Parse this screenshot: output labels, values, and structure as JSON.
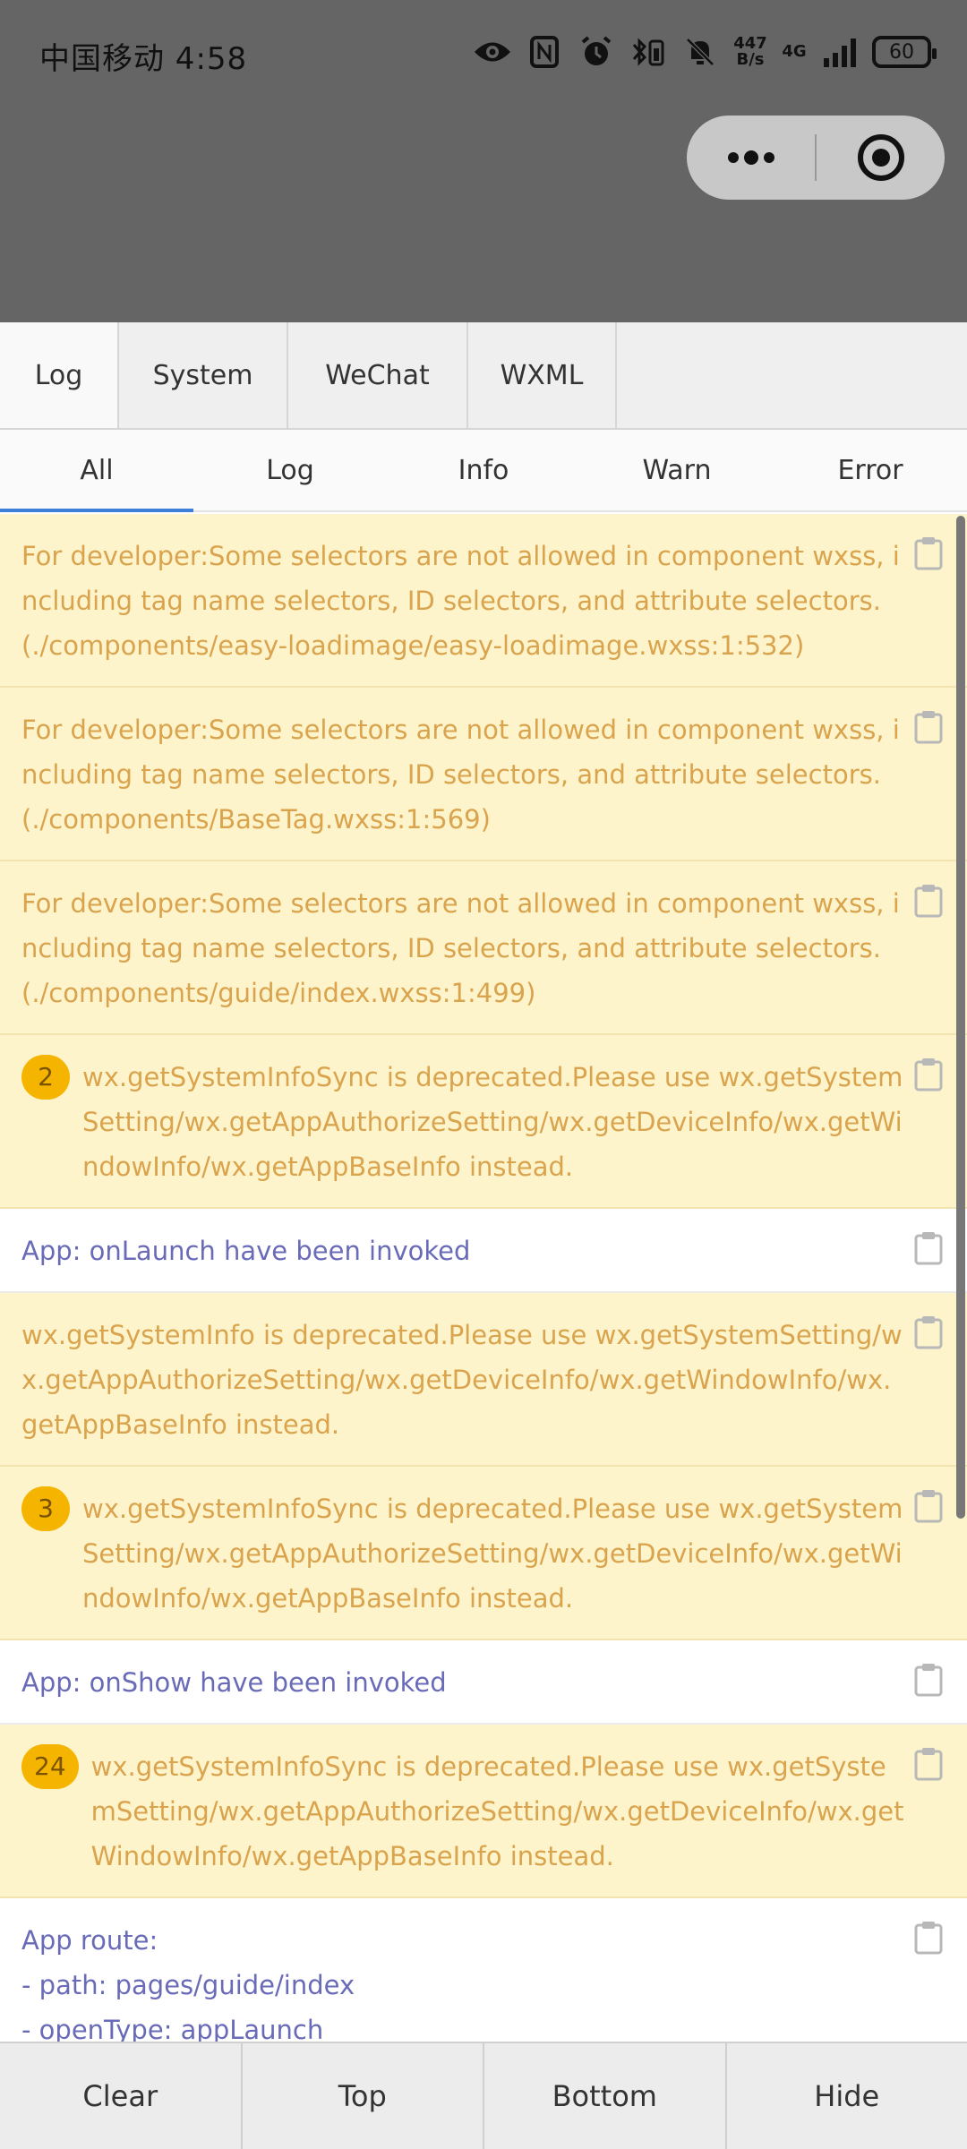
{
  "status_bar": {
    "carrier_time": "中国移动 4:58",
    "net_speed_top": "447",
    "net_speed_bottom": "B/s",
    "network": "4G",
    "battery": "60"
  },
  "tabs": [
    {
      "label": "Log"
    },
    {
      "label": "System"
    },
    {
      "label": "WeChat"
    },
    {
      "label": "WXML"
    }
  ],
  "filters": [
    {
      "label": "All"
    },
    {
      "label": "Log"
    },
    {
      "label": "Info"
    },
    {
      "label": "Warn"
    },
    {
      "label": "Error"
    }
  ],
  "logs": [
    {
      "text": "For developer:Some selectors are not allowed in component wxss, including tag name selectors, ID selectors, and attribute selectors.(./components/easy-loadimage/easy-loadimage.wxss:1:532)"
    },
    {
      "text": "For developer:Some selectors are not allowed in component wxss, including tag name selectors, ID selectors, and attribute selectors.(./components/BaseTag.wxss:1:569)"
    },
    {
      "text": "For developer:Some selectors are not allowed in component wxss, including tag name selectors, ID selectors, and attribute selectors.(./components/guide/index.wxss:1:499)"
    },
    {
      "count": "2",
      "text": "wx.getSystemInfoSync is deprecated.Please use wx.getSystemSetting/wx.getAppAuthorizeSetting/wx.getDeviceInfo/wx.getWindowInfo/wx.getAppBaseInfo instead."
    },
    {
      "text": "App: onLaunch have been invoked"
    },
    {
      "text": "wx.getSystemInfo is deprecated.Please use wx.getSystemSetting/wx.getAppAuthorizeSetting/wx.getDeviceInfo/wx.getWindowInfo/wx.getAppBaseInfo instead."
    },
    {
      "count": "3",
      "text": "wx.getSystemInfoSync is deprecated.Please use wx.getSystemSetting/wx.getAppAuthorizeSetting/wx.getDeviceInfo/wx.getWindowInfo/wx.getAppBaseInfo instead."
    },
    {
      "text": "App: onShow have been invoked"
    },
    {
      "count": "24",
      "text": "wx.getSystemInfoSync is deprecated.Please use wx.getSystemSetting/wx.getAppAuthorizeSetting/wx.getDeviceInfo/wx.getWindowInfo/wx.getAppBaseInfo instead."
    },
    {
      "text": "App route:\n- path: pages/guide/index\n- openType: appLaunch"
    }
  ],
  "footer": {
    "clear": "Clear",
    "top": "Top",
    "bottom": "Bottom",
    "hide": "Hide"
  }
}
